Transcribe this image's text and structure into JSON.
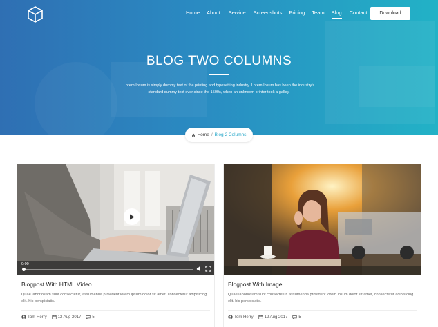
{
  "nav": {
    "items": [
      {
        "label": "Home"
      },
      {
        "label": "About"
      },
      {
        "label": "Service"
      },
      {
        "label": "Screenshots"
      },
      {
        "label": "Pricing"
      },
      {
        "label": "Team"
      },
      {
        "label": "Blog",
        "active": true
      },
      {
        "label": "Contact"
      }
    ],
    "download_label": "Download"
  },
  "hero": {
    "title": "BLOG TWO COLUMNS",
    "description_line1": "Lorem Ipsum is simply dummy text of the printing and typesetting industry. Lorem Ipsum has been the industry's",
    "description_line2": "standard dummy text ever since the 1500s, when an unknown printer took a galley."
  },
  "breadcrumb": {
    "home": "Home",
    "separator": "/",
    "current": "Blog 2 Columns"
  },
  "posts": [
    {
      "title": "Blogpost With HTML Video",
      "excerpt": "Quae laboriosam sunt consectetur, assumenda provident lorem ipsum dolor sit amet, consectetur adipisicing elit. hic perspiciatis.",
      "author": "Tom Herry",
      "date": "12 Aug 2017",
      "comments": "5",
      "video_time": "0:00",
      "video_progress_percent": 0
    },
    {
      "title": "Blogpost With Image",
      "excerpt": "Quae laboriosam sunt consectetur, assumenda provident lorem ipsum dolor sit amet, consectetur adipisicing elit. hic perspiciatis.",
      "author": "Tom Herry",
      "date": "12 Aug 2017",
      "comments": "5"
    }
  ],
  "colors": {
    "accent": "#27a7c9",
    "hero_gradient_start": "#2f6fb3",
    "hero_gradient_end": "#22b2c6"
  }
}
